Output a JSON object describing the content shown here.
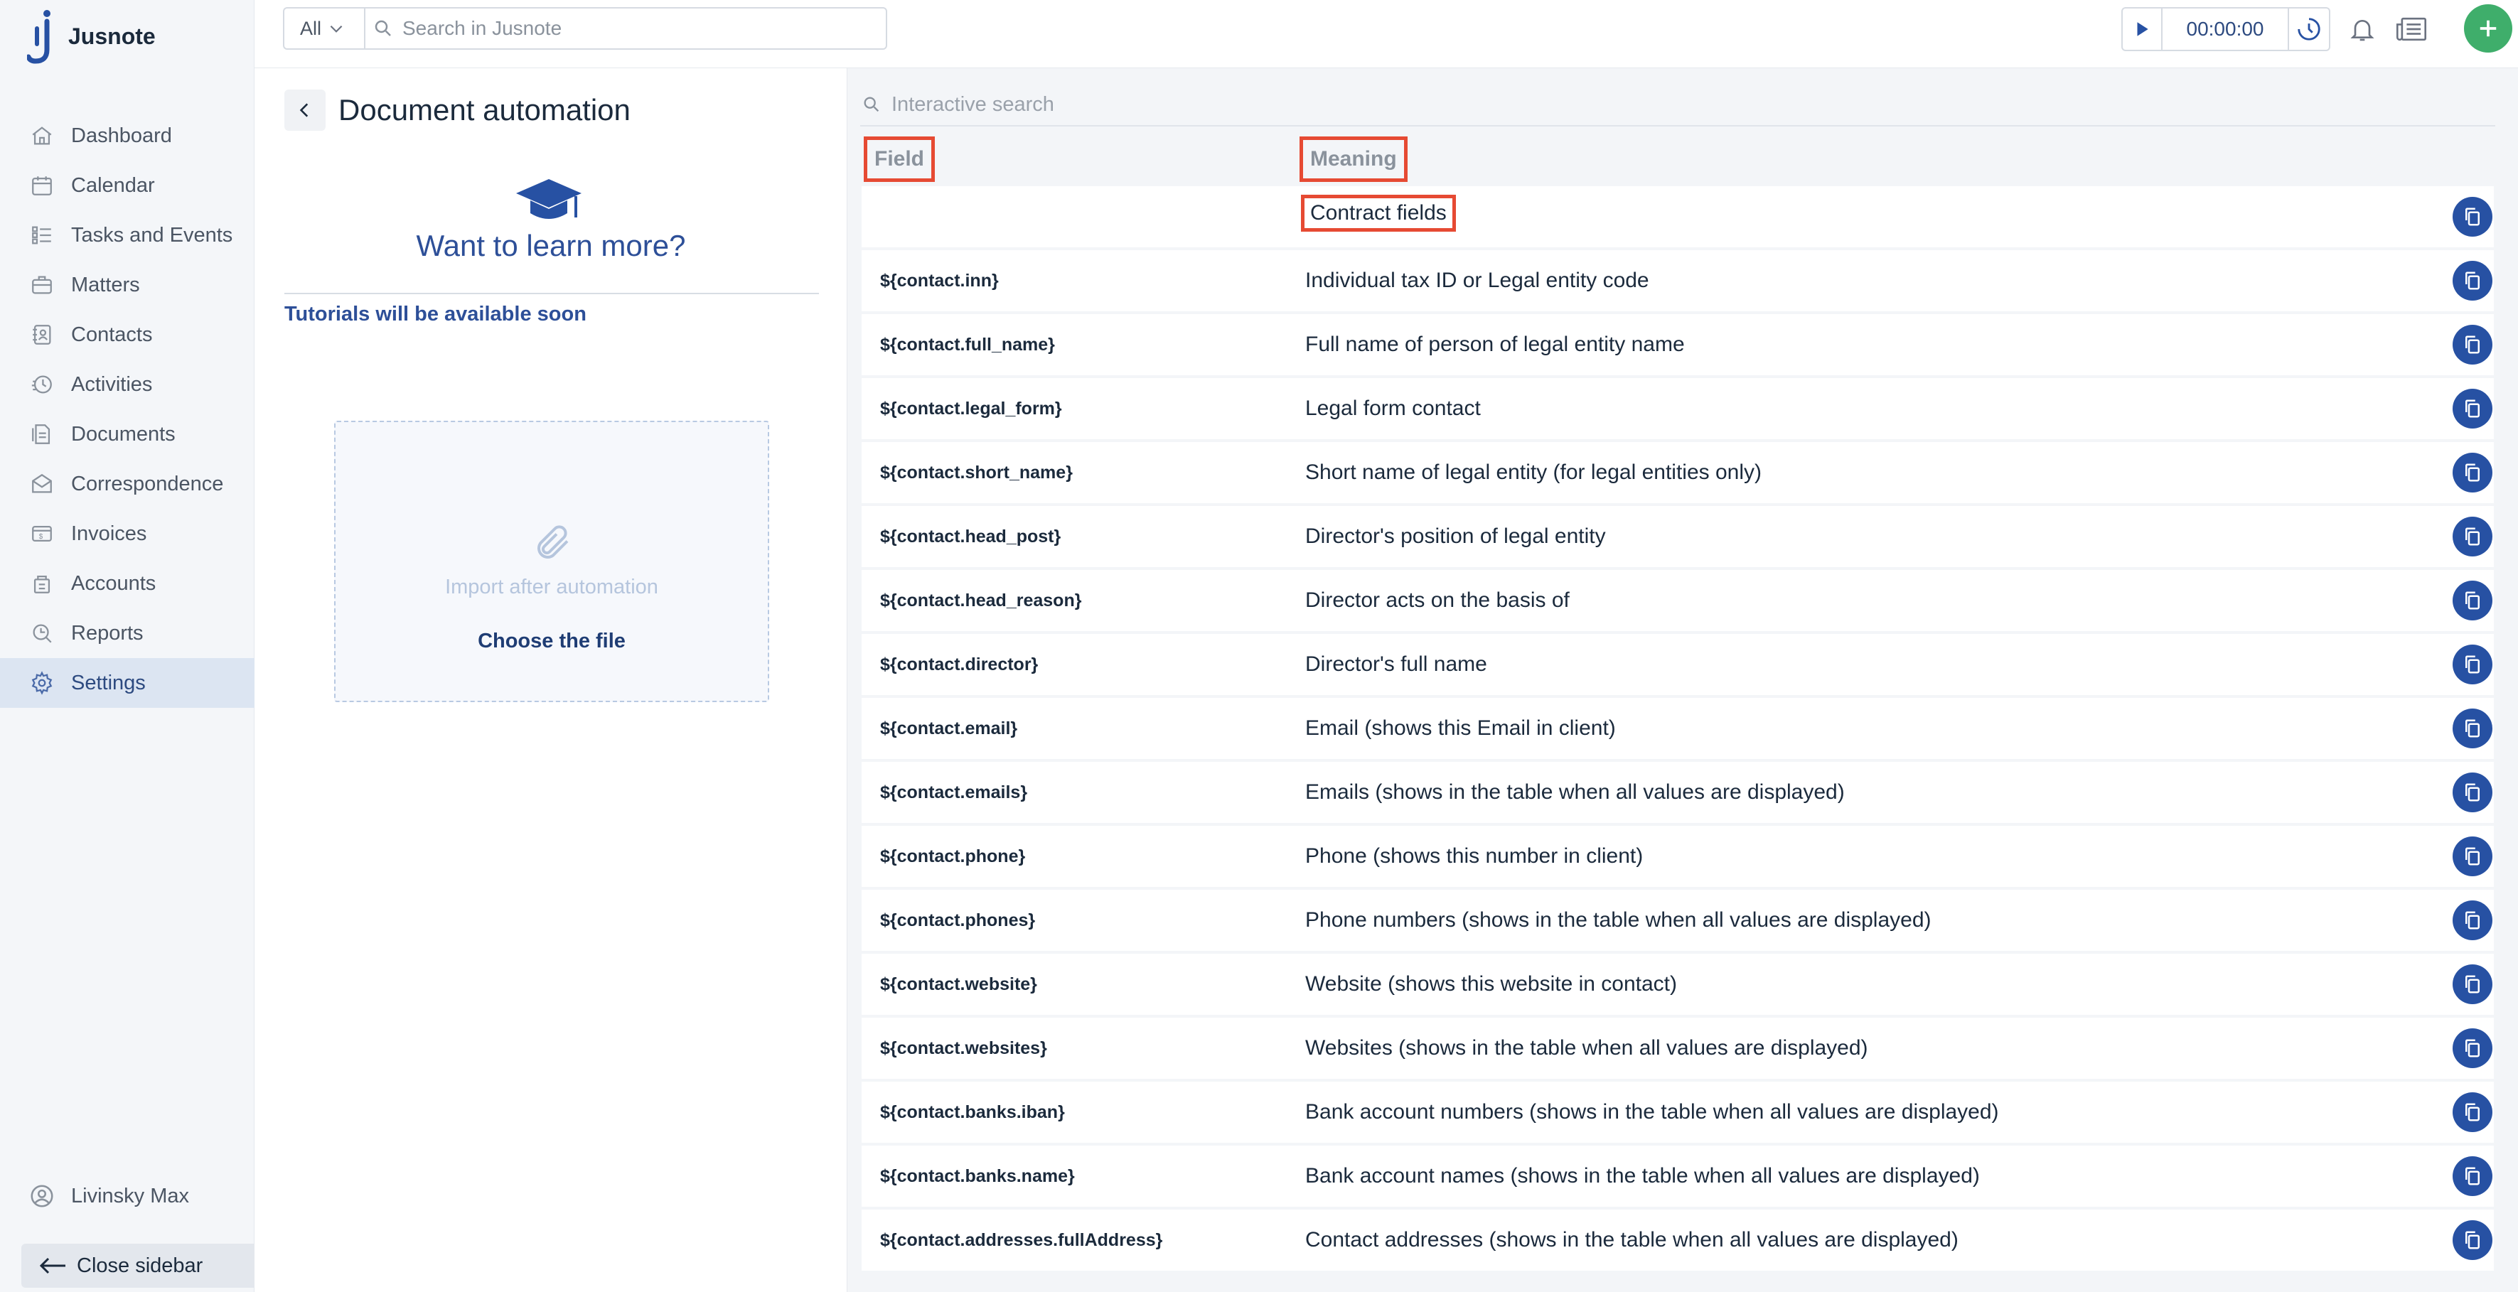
{
  "app": {
    "name": "Jusnote"
  },
  "colors": {
    "accent": "#2751a3",
    "sidebar_active": "#dce5f2",
    "add_button": "#3fae6b",
    "highlight_box": "#e64a33"
  },
  "sidebar": {
    "items": [
      {
        "label": "Dashboard",
        "icon": "home-icon"
      },
      {
        "label": "Calendar",
        "icon": "calendar-icon"
      },
      {
        "label": "Tasks and Events",
        "icon": "tasks-icon"
      },
      {
        "label": "Matters",
        "icon": "briefcase-icon"
      },
      {
        "label": "Contacts",
        "icon": "contacts-icon"
      },
      {
        "label": "Activities",
        "icon": "activity-icon"
      },
      {
        "label": "Documents",
        "icon": "documents-icon"
      },
      {
        "label": "Correspondence",
        "icon": "correspondence-icon"
      },
      {
        "label": "Invoices",
        "icon": "invoice-icon"
      },
      {
        "label": "Accounts",
        "icon": "accounts-icon"
      },
      {
        "label": "Reports",
        "icon": "reports-icon"
      },
      {
        "label": "Settings",
        "icon": "gear-icon",
        "active": true
      }
    ],
    "user": "Livinsky Max",
    "close_label": "Close sidebar"
  },
  "topbar": {
    "scope": "All",
    "search_placeholder": "Search in Jusnote",
    "timer": "00:00:00"
  },
  "left_panel": {
    "title": "Document automation",
    "learn_title": "Want to learn more?",
    "tutorials": "Tutorials will be available soon",
    "dropzone": {
      "import_label": "Import after automation",
      "choose_label": "Choose the file"
    }
  },
  "right_panel": {
    "search_placeholder": "Interactive search",
    "columns": {
      "field": "Field",
      "meaning": "Meaning"
    },
    "rows": [
      {
        "field": "",
        "meaning": "Contract fields"
      },
      {
        "field": "${contact.inn}",
        "meaning": "Individual tax ID or Legal entity code"
      },
      {
        "field": "${contact.full_name}",
        "meaning": "Full name of person of legal entity name"
      },
      {
        "field": "${contact.legal_form}",
        "meaning": "Legal form contact"
      },
      {
        "field": "${contact.short_name}",
        "meaning": "Short name of legal entity (for legal entities only)"
      },
      {
        "field": "${contact.head_post}",
        "meaning": "Director's position of legal entity"
      },
      {
        "field": "${contact.head_reason}",
        "meaning": "Director acts on the basis of"
      },
      {
        "field": "${contact.director}",
        "meaning": "Director's full name"
      },
      {
        "field": "${contact.email}",
        "meaning": "Email (shows this Email in client)"
      },
      {
        "field": "${contact.emails}",
        "meaning": "Emails (shows in the table when all values are displayed)"
      },
      {
        "field": "${contact.phone}",
        "meaning": "Phone (shows this number in client)"
      },
      {
        "field": "${contact.phones}",
        "meaning": "Phone numbers (shows in the table when all values are displayed)"
      },
      {
        "field": "${contact.website}",
        "meaning": "Website (shows this website in contact)"
      },
      {
        "field": "${contact.websites}",
        "meaning": "Websites (shows in the table when all values are displayed)"
      },
      {
        "field": "${contact.banks.iban}",
        "meaning": "Bank account numbers (shows in the table when all values are displayed)"
      },
      {
        "field": "${contact.banks.name}",
        "meaning": "Bank account names (shows in the table when all values are displayed)"
      },
      {
        "field": "${contact.addresses.fullAddress}",
        "meaning": "Contact addresses (shows in the table when all values are displayed)"
      }
    ]
  }
}
